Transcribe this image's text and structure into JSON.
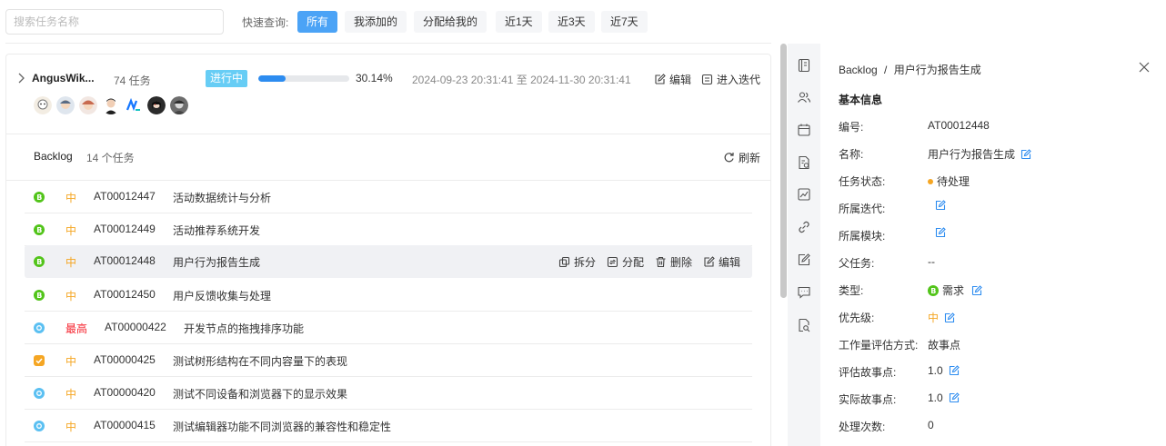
{
  "search": {
    "placeholder": "搜索任务名称"
  },
  "quick_filter": {
    "label": "快速查询:",
    "options": [
      {
        "label": "所有",
        "active": true
      },
      {
        "label": "我添加的",
        "active": false
      },
      {
        "label": "分配给我的",
        "active": false
      },
      {
        "label": "近1天",
        "active": false
      },
      {
        "label": "近3天",
        "active": false
      },
      {
        "label": "近7天",
        "active": false
      }
    ]
  },
  "sprint": {
    "name": "AngusWik...",
    "task_count": "74 任务",
    "status": "进行中",
    "progress_percent": 30.14,
    "progress_text": "30.14%",
    "date_range": "2024-09-23 20:31:41 至 2024-11-30 20:31:41",
    "edit_label": "编辑",
    "enter_label": "进入迭代",
    "avatar_count": 8
  },
  "backlog": {
    "title": "Backlog",
    "count": "14 个任务",
    "refresh_label": "刷新",
    "row_actions": {
      "split": "拆分",
      "assign": "分配",
      "delete": "删除",
      "edit": "编辑"
    },
    "tasks": [
      {
        "type": "story",
        "priority": "中",
        "code": "AT00012447",
        "name": "活动数据统计与分析"
      },
      {
        "type": "story",
        "priority": "中",
        "code": "AT00012449",
        "name": "活动推荐系统开发"
      },
      {
        "type": "story",
        "priority": "中",
        "code": "AT00012448",
        "name": "用户行为报告生成"
      },
      {
        "type": "story",
        "priority": "中",
        "code": "AT00012450",
        "name": "用户反馈收集与处理"
      },
      {
        "type": "task",
        "priority": "最高",
        "code": "AT00000422",
        "name": "开发节点的拖拽排序功能"
      },
      {
        "type": "test",
        "priority": "中",
        "code": "AT00000425",
        "name": "测试树形结构在不同内容量下的表现"
      },
      {
        "type": "task",
        "priority": "中",
        "code": "AT00000420",
        "name": "测试不同设备和浏览器下的显示效果"
      },
      {
        "type": "task",
        "priority": "中",
        "code": "AT00000415",
        "name": "测试编辑器功能不同浏览器的兼容性和稳定性"
      }
    ]
  },
  "colors": {
    "accent": "#4ba3f6",
    "progress": "#2d8cf0",
    "status_tag": "#67cdf5",
    "priority_medium": "#f5a623",
    "priority_highest": "#f5222d",
    "story_green": "#52c41a",
    "task_blue": "#5bc0f2",
    "test_orange": "#f5a623"
  },
  "detail": {
    "breadcrumb_parent": "Backlog",
    "breadcrumb_sep": "/",
    "breadcrumb_current": "用户行为报告生成",
    "section_title": "基本信息",
    "fields": [
      {
        "label": "编号:",
        "value": "AT00012448",
        "editable": false
      },
      {
        "label": "名称:",
        "value": "用户行为报告生成",
        "editable": true
      },
      {
        "label": "任务状态:",
        "value": "待处理",
        "editable": false,
        "dot": true
      },
      {
        "label": "所属迭代:",
        "value": "",
        "editable": true
      },
      {
        "label": "所属模块:",
        "value": "",
        "editable": true
      },
      {
        "label": "父任务:",
        "value": "--",
        "editable": false
      },
      {
        "label": "类型:",
        "value": "需求",
        "editable": true,
        "badge": true
      },
      {
        "label": "优先级:",
        "value": "中",
        "editable": true,
        "priority": true
      },
      {
        "label": "工作量评估方式:",
        "value": "故事点",
        "editable": false
      },
      {
        "label": "评估故事点:",
        "value": "1.0",
        "editable": true
      },
      {
        "label": "实际故事点:",
        "value": "1.0",
        "editable": true
      },
      {
        "label": "处理次数:",
        "value": "0",
        "editable": false
      }
    ]
  },
  "sidebar_icons": [
    "basic-info-icon",
    "people-icon",
    "calendar-icon",
    "file-check-icon",
    "chart-icon",
    "link-icon",
    "edit-note-icon",
    "comment-icon",
    "search-doc-icon"
  ]
}
